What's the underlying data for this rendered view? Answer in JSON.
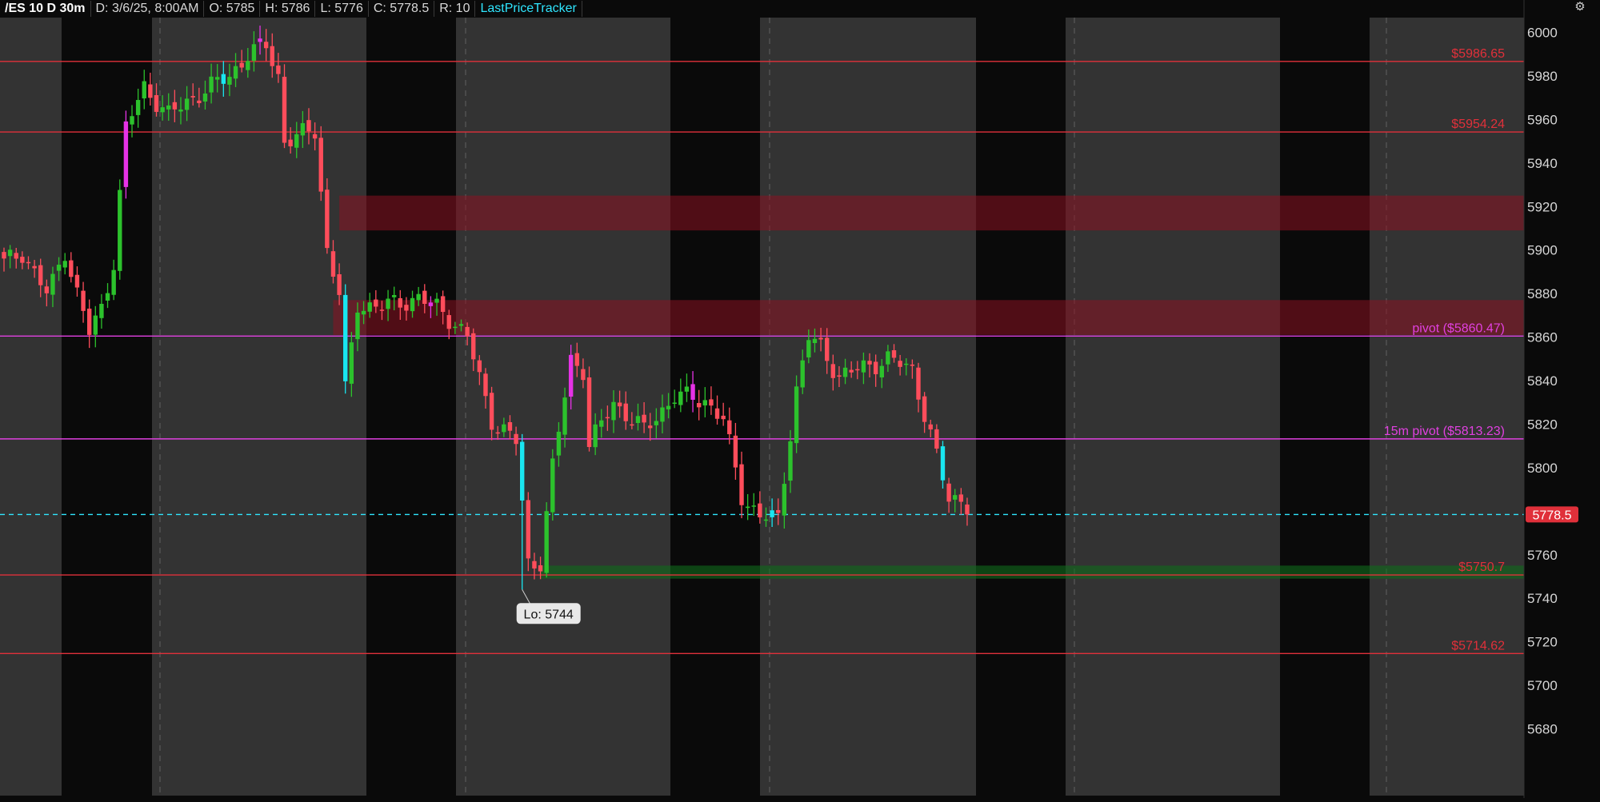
{
  "header": {
    "symbol": "/ES 10 D 30m",
    "date": "D: 3/6/25, 8:00AM",
    "open": "O: 5785",
    "high": "H: 5786",
    "low": "L: 5776",
    "close": "C: 5778.5",
    "range": "R: 10",
    "study": "LastPriceTracker"
  },
  "colors": {
    "background": "#0a0a0a",
    "session_band": "#333333",
    "up_candle": "#2cc22c",
    "down_candle": "#ff4d5b",
    "highlight_candle_cyan": "#19e6f0",
    "highlight_candle_magenta": "#e632e6",
    "resistance_line": "#e0303a",
    "pivot_line": "#e040e0",
    "last_price": "#2fe6ff",
    "supply_zone": "#8a1020",
    "demand_zone": "#0f6a1a"
  },
  "chart_data": {
    "type": "candlestick",
    "interval": "30m",
    "span": "10 D",
    "ylim": [
      5673,
      6012
    ],
    "yticks": [
      5680,
      5700,
      5720,
      5740,
      5760,
      5780,
      5800,
      5820,
      5840,
      5860,
      5880,
      5900,
      5920,
      5940,
      5960,
      5980,
      6000
    ],
    "last_price": {
      "value": 5778.5,
      "label": "5778.5"
    },
    "levels": [
      {
        "value": 5986.65,
        "label": "$5986.65",
        "kind": "resistance"
      },
      {
        "value": 5954.24,
        "label": "$5954.24",
        "kind": "resistance"
      },
      {
        "value": 5860.47,
        "label": "pivot ($5860.47)",
        "kind": "pivot"
      },
      {
        "value": 5813.23,
        "label": "15m pivot ($5813.23)",
        "kind": "pivot"
      },
      {
        "value": 5750.7,
        "label": "$5750.7",
        "kind": "resistance"
      },
      {
        "value": 5714.62,
        "label": "$5714.62",
        "kind": "resistance"
      }
    ],
    "zones": [
      {
        "from_bar": 55,
        "low": 5909,
        "high": 5925,
        "kind": "supply"
      },
      {
        "from_bar": 54,
        "low": 5861,
        "high": 5877,
        "kind": "supply"
      },
      {
        "from_bar": 88,
        "low": 5749,
        "high": 5755,
        "kind": "demand"
      }
    ],
    "annotation": {
      "bar": 85,
      "price": 5744,
      "text": "Lo: 5744"
    },
    "anchors": [
      [
        0,
        5894
      ],
      [
        3,
        5899
      ],
      [
        7,
        5880
      ],
      [
        8,
        5885
      ],
      [
        10,
        5900
      ],
      [
        12,
        5880
      ],
      [
        14,
        5862
      ],
      [
        16,
        5873
      ],
      [
        18,
        5895
      ],
      [
        20,
        5956
      ],
      [
        23,
        5975
      ],
      [
        27,
        5962
      ],
      [
        32,
        5972
      ],
      [
        37,
        5980
      ],
      [
        40,
        5990
      ],
      [
        43,
        5994
      ],
      [
        45,
        5980
      ],
      [
        46,
        5950
      ],
      [
        51,
        5955
      ],
      [
        53,
        5900
      ],
      [
        55,
        5880
      ],
      [
        56,
        5835
      ],
      [
        58,
        5875
      ],
      [
        62,
        5874
      ],
      [
        68,
        5878
      ],
      [
        72,
        5872
      ],
      [
        76,
        5860
      ],
      [
        80,
        5822
      ],
      [
        84,
        5812
      ],
      [
        86,
        5756
      ],
      [
        88,
        5757
      ],
      [
        90,
        5800
      ],
      [
        93,
        5850
      ],
      [
        95,
        5845
      ],
      [
        96,
        5810
      ],
      [
        100,
        5830
      ],
      [
        105,
        5817
      ],
      [
        110,
        5833
      ],
      [
        115,
        5831
      ],
      [
        118,
        5822
      ],
      [
        121,
        5787
      ],
      [
        124,
        5778
      ],
      [
        127,
        5776
      ],
      [
        130,
        5836
      ],
      [
        132,
        5860
      ],
      [
        134,
        5855
      ],
      [
        137,
        5842
      ],
      [
        145,
        5850
      ],
      [
        149,
        5845
      ],
      [
        152,
        5815
      ],
      [
        155,
        5785
      ],
      [
        157,
        5786
      ],
      [
        158,
        5778.5
      ]
    ],
    "accent_bars": [
      {
        "bar": 20,
        "color": "magenta"
      },
      {
        "bar": 36,
        "color": "cyan"
      },
      {
        "bar": 42,
        "color": "magenta"
      },
      {
        "bar": 56,
        "color": "cyan"
      },
      {
        "bar": 70,
        "color": "magenta"
      },
      {
        "bar": 85,
        "color": "cyan"
      },
      {
        "bar": 93,
        "color": "magenta"
      },
      {
        "bar": 113,
        "color": "magenta"
      },
      {
        "bar": 126,
        "color": "cyan"
      },
      {
        "bar": 154,
        "color": "cyan"
      }
    ]
  }
}
